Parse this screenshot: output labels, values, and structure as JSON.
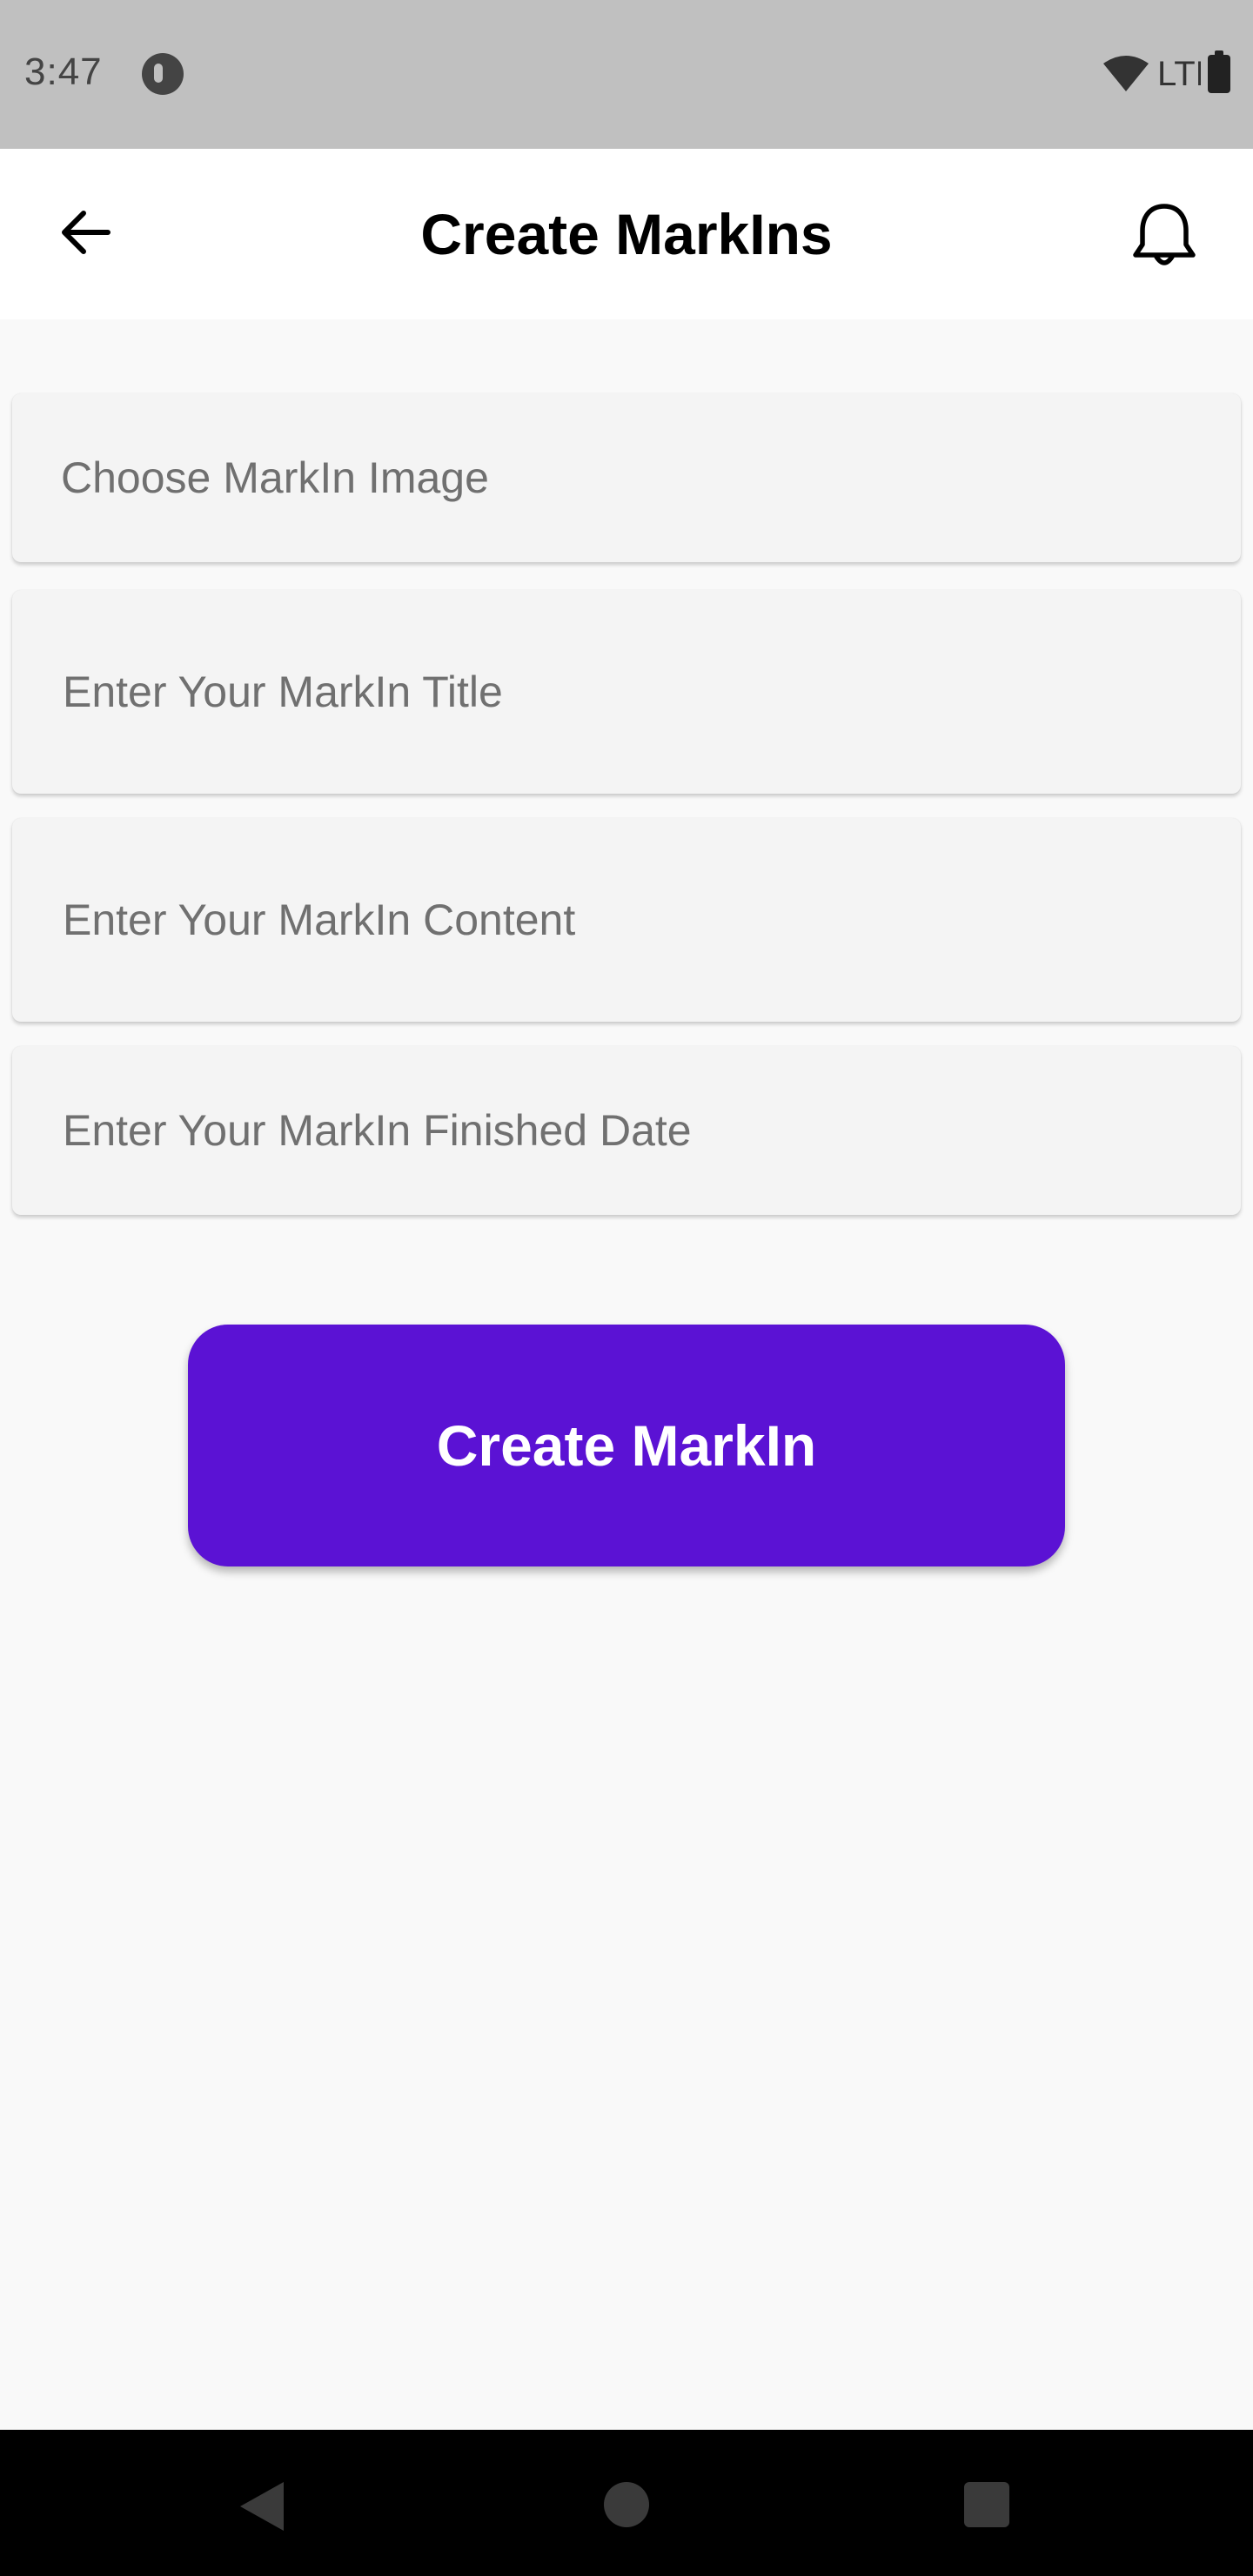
{
  "status_bar": {
    "time": "3:47",
    "network": "LTE"
  },
  "header": {
    "title": "Create MarkIns",
    "back_icon": "arrow-left-icon",
    "notification_icon": "bell-icon"
  },
  "form": {
    "image_label": "Choose MarkIn Image",
    "title_placeholder": "Enter Your MarkIn Title",
    "content_placeholder": "Enter Your MarkIn Content",
    "date_placeholder": "Enter Your MarkIn Finished Date",
    "submit_label": "Create MarkIn"
  },
  "colors": {
    "accent": "#5b12d4",
    "status_bar": "#c0c0c0",
    "field_background": "#f4f4f4",
    "page_background": "#f9f9f9"
  }
}
